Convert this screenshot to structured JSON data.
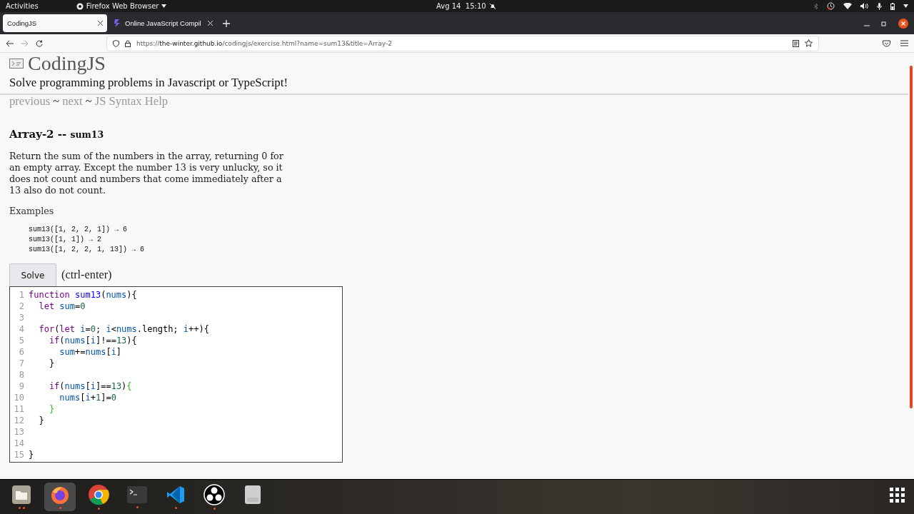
{
  "top_bar": {
    "activities": "Activities",
    "app_menu": "Firefox Web Browser",
    "clock": "Avg 14  15:10"
  },
  "tabs": [
    {
      "title": "CodingJS",
      "selected": true,
      "kind": "page"
    },
    {
      "title": "Online JavaScript Compil",
      "selected": false,
      "kind": "compiler"
    }
  ],
  "address": {
    "scheme": "https://",
    "host": "the-winter.github.io",
    "path": "/codingjs/exercise.html?name=sum13&title=Array-2"
  },
  "page": {
    "site_title": "CodingJS",
    "tagline": "Solve programming problems in Javascript or TypeScript!",
    "nav": [
      {
        "kind": "link",
        "text": "previous"
      },
      {
        "kind": "sep",
        "text": "~"
      },
      {
        "kind": "link",
        "text": "next"
      },
      {
        "kind": "sep",
        "text": "~"
      },
      {
        "kind": "link",
        "text": "JS Syntax Help"
      }
    ],
    "heading": {
      "category": "Array-2 --",
      "name": "sum13"
    },
    "description": "Return the sum of the numbers in the array, returning 0 for an empty array. Except the number 13 is very unlucky, so it does not count and numbers that come immediately after a 13 also do not count.",
    "examples_label": "Examples",
    "examples": [
      "sum13([1, 2, 2, 1]) → 6",
      "sum13([1, 1]) → 2",
      "sum13([1, 2, 2, 1, 13]) → 6"
    ],
    "solve_button": "Solve",
    "shortcut": "(ctrl-enter)",
    "code": [
      {
        "number": "1",
        "tokens": [
          {
            "kind": "keyword",
            "text": "function"
          },
          {
            "kind": "def",
            "text": " sum13"
          },
          {
            "kind": "plain",
            "text": "("
          },
          {
            "kind": "var",
            "text": "nums"
          },
          {
            "kind": "plain",
            "text": "){"
          }
        ]
      },
      {
        "number": "2",
        "tokens": [
          {
            "kind": "keyword",
            "text": "  let"
          },
          {
            "kind": "var",
            "text": " sum"
          },
          {
            "kind": "plain",
            "text": "="
          },
          {
            "kind": "number",
            "text": "0"
          }
        ]
      },
      {
        "number": "3"
      },
      {
        "number": "4",
        "tokens": [
          {
            "kind": "keyword",
            "text": "  for"
          },
          {
            "kind": "plain",
            "text": "("
          },
          {
            "kind": "keyword",
            "text": "let"
          },
          {
            "kind": "var",
            "text": " i"
          },
          {
            "kind": "plain",
            "text": "="
          },
          {
            "kind": "number",
            "text": "0"
          },
          {
            "kind": "plain",
            "text": "; "
          },
          {
            "kind": "var",
            "text": "i"
          },
          {
            "kind": "plain",
            "text": "<"
          },
          {
            "kind": "var",
            "text": "nums"
          },
          {
            "kind": "plain",
            "text": ".length; "
          },
          {
            "kind": "var",
            "text": "i"
          },
          {
            "kind": "plain",
            "text": "++){"
          }
        ]
      },
      {
        "number": "5",
        "tokens": [
          {
            "kind": "keyword",
            "text": "    if"
          },
          {
            "kind": "plain",
            "text": "("
          },
          {
            "kind": "var",
            "text": "nums"
          },
          {
            "kind": "plain",
            "text": "["
          },
          {
            "kind": "var",
            "text": "i"
          },
          {
            "kind": "plain",
            "text": "]!=="
          },
          {
            "kind": "number",
            "text": "13"
          },
          {
            "kind": "plain",
            "text": "){"
          }
        ]
      },
      {
        "number": "6",
        "tokens": [
          {
            "kind": "var",
            "text": "      sum"
          },
          {
            "kind": "plain",
            "text": "+="
          },
          {
            "kind": "var",
            "text": "nums"
          },
          {
            "kind": "plain",
            "text": "["
          },
          {
            "kind": "var",
            "text": "i"
          },
          {
            "kind": "plain",
            "text": "]"
          }
        ]
      },
      {
        "number": "7",
        "tokens": [
          {
            "kind": "plain",
            "text": "    }"
          }
        ]
      },
      {
        "number": "8"
      },
      {
        "number": "9",
        "tokens": [
          {
            "kind": "keyword",
            "text": "    if"
          },
          {
            "kind": "plain",
            "text": "("
          },
          {
            "kind": "var",
            "text": "nums"
          },
          {
            "kind": "plain",
            "text": "["
          },
          {
            "kind": "var",
            "text": "i"
          },
          {
            "kind": "plain",
            "text": "]=="
          },
          {
            "kind": "number",
            "text": "13"
          },
          {
            "kind": "plain",
            "text": ")"
          },
          {
            "kind": "match",
            "text": "{"
          }
        ]
      },
      {
        "number": "10",
        "tokens": [
          {
            "kind": "var",
            "text": "      nums"
          },
          {
            "kind": "plain",
            "text": "["
          },
          {
            "kind": "var",
            "text": "i"
          },
          {
            "kind": "plain",
            "text": "+"
          },
          {
            "kind": "number",
            "text": "1"
          },
          {
            "kind": "plain",
            "text": "]="
          },
          {
            "kind": "number",
            "text": "0"
          }
        ]
      },
      {
        "number": "11",
        "tokens": [
          {
            "kind": "match",
            "text": "    }"
          }
        ]
      },
      {
        "number": "12",
        "tokens": [
          {
            "kind": "plain",
            "text": "  }"
          }
        ]
      },
      {
        "number": "13"
      },
      {
        "number": "14"
      },
      {
        "number": "15",
        "tokens": [
          {
            "kind": "plain",
            "text": "}"
          }
        ]
      }
    ]
  },
  "dock": [
    {
      "kind": "files",
      "running": true,
      "multi": true,
      "selected": false
    },
    {
      "kind": "firefox",
      "running": true,
      "multi": false,
      "selected": true
    },
    {
      "kind": "chrome",
      "running": true,
      "multi": false,
      "selected": false
    },
    {
      "kind": "terminal",
      "running": true,
      "multi": false,
      "selected": false
    },
    {
      "kind": "vscode",
      "running": true,
      "multi": false,
      "selected": false
    },
    {
      "kind": "obs",
      "running": true,
      "multi": false,
      "selected": false
    },
    {
      "kind": "disk",
      "running": false,
      "selected": false
    }
  ]
}
